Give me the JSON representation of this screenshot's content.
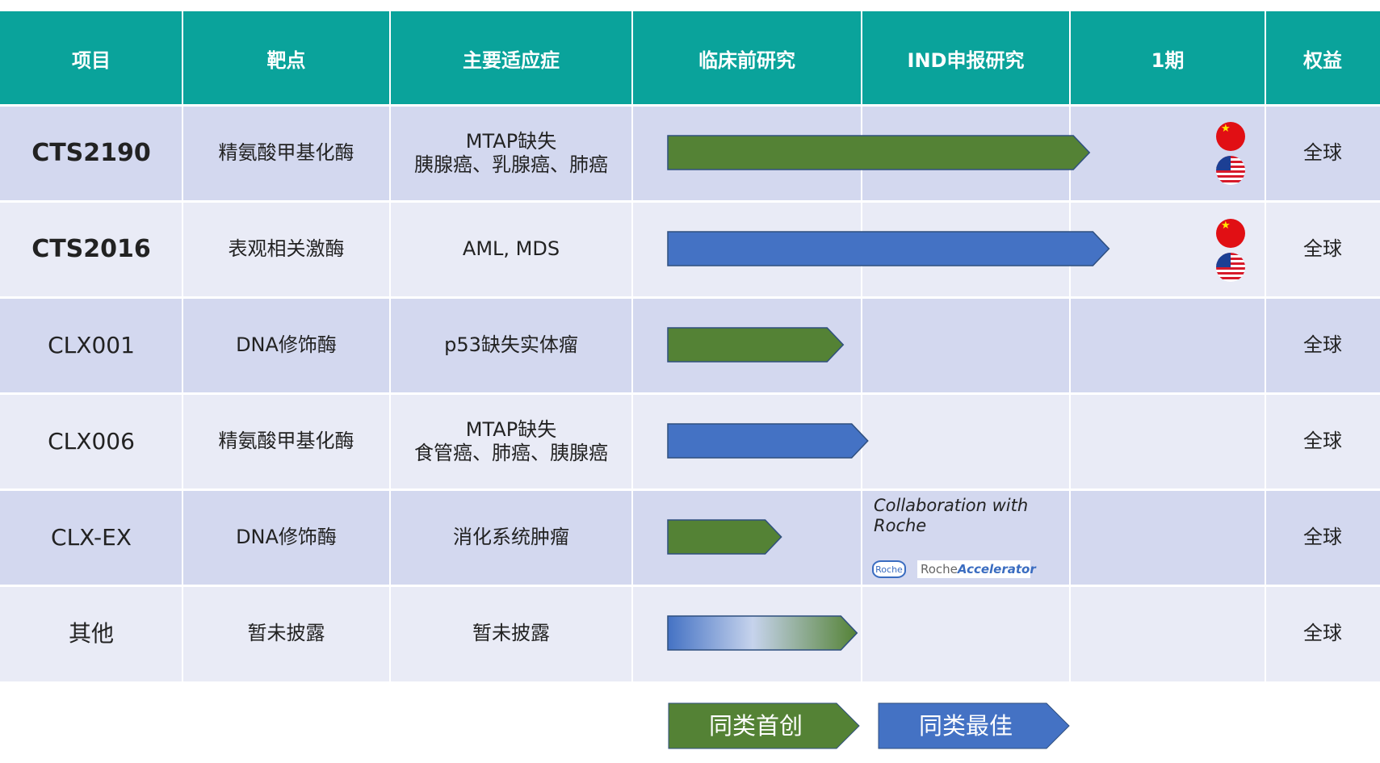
{
  "chart_data": {
    "type": "table",
    "stage_columns": [
      "临床前研究",
      "IND申报研究",
      "1期"
    ],
    "rows": [
      {
        "project": "CTS2190",
        "target": "精氨酸甲基化酶",
        "indication": [
          "MTAP缺失",
          "胰腺癌、乳腺癌、肺癌"
        ],
        "progress_stages": 2.1,
        "category": "first",
        "flags": [
          "CN",
          "US"
        ],
        "region": "全球"
      },
      {
        "project": "CTS2016",
        "target": "表观相关激酶",
        "indication": [
          "AML, MDS"
        ],
        "progress_stages": 2.2,
        "category": "best",
        "flags": [
          "CN",
          "US"
        ],
        "region": "全球"
      },
      {
        "project": "CLX001",
        "target": "DNA修饰酶",
        "indication": [
          "p53缺失实体瘤"
        ],
        "progress_stages": 0.92,
        "category": "first",
        "flags": [],
        "region": "全球"
      },
      {
        "project": "CLX006",
        "target": "精氨酸甲基化酶",
        "indication": [
          "MTAP缺失",
          "食管癌、肺癌、胰腺癌"
        ],
        "progress_stages": 1.03,
        "category": "best",
        "flags": [],
        "region": "全球"
      },
      {
        "project": "CLX-EX",
        "target": "DNA修饰酶",
        "indication": [
          "消化系统肿瘤"
        ],
        "progress_stages": 0.65,
        "category": "first",
        "flags": [],
        "region": "全球",
        "note": [
          "Collaboration with",
          "Roche"
        ]
      },
      {
        "project": "其他",
        "target": "暂未披露",
        "indication": [
          "暂未披露"
        ],
        "progress_stages": 0.98,
        "category": "mixed",
        "flags": [],
        "region": "全球"
      }
    ],
    "legend": [
      {
        "key": "first",
        "label": "同类首创",
        "color": "#548235"
      },
      {
        "key": "best",
        "label": "同类最佳",
        "color": "#4472c4"
      }
    ]
  },
  "header": {
    "project": "项目",
    "target": "靶点",
    "indication": "主要适应症",
    "preclinical": "临床前研究",
    "ind": "IND申报研究",
    "phase1": "1期",
    "region": "权益"
  },
  "collab": {
    "roche_logo_text": "Roche",
    "accelerator_prefix": "Roche",
    "accelerator_suffix": "Accelerator"
  },
  "colors": {
    "header_bg": "#0aa39b",
    "row_dark": "#d3d8ef",
    "row_light": "#e9ebf6",
    "first_in_class": "#548235",
    "best_in_class": "#4472c4"
  }
}
